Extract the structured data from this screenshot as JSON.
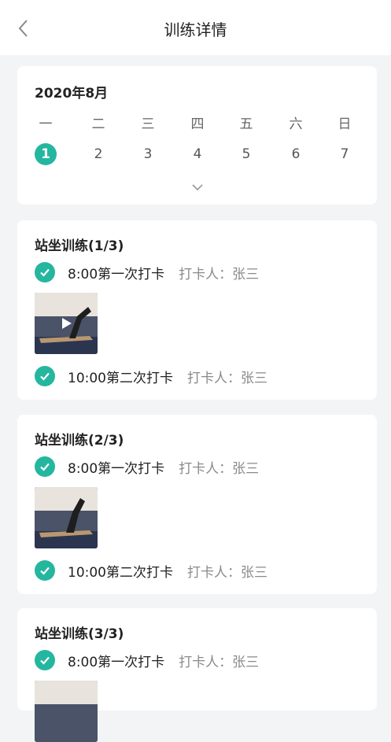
{
  "header": {
    "title": "训练详情"
  },
  "calendar": {
    "month": "2020年8月",
    "weekdays": [
      "一",
      "二",
      "三",
      "四",
      "五",
      "六",
      "日"
    ],
    "days": [
      "1",
      "2",
      "3",
      "4",
      "5",
      "6",
      "7"
    ],
    "selected_day": "1"
  },
  "trainings": [
    {
      "title": "站坐训练(1/3)",
      "checkins": [
        {
          "time": "8:00第一次打卡",
          "by": "打卡人：张三"
        },
        {
          "time": "10:00第二次打卡",
          "by": "打卡人：张三"
        }
      ]
    },
    {
      "title": "站坐训练(2/3)",
      "checkins": [
        {
          "time": "8:00第一次打卡",
          "by": "打卡人：张三"
        },
        {
          "time": "10:00第二次打卡",
          "by": "打卡人：张三"
        }
      ]
    },
    {
      "title": "站坐训练(3/3)",
      "checkins": [
        {
          "time": "8:00第一次打卡",
          "by": "打卡人：张三"
        }
      ]
    }
  ],
  "colors": {
    "accent": "#25b6a0"
  },
  "icons": {
    "back": "back-icon",
    "expand": "chevron-down-icon",
    "check": "check-icon",
    "play": "play-icon"
  }
}
